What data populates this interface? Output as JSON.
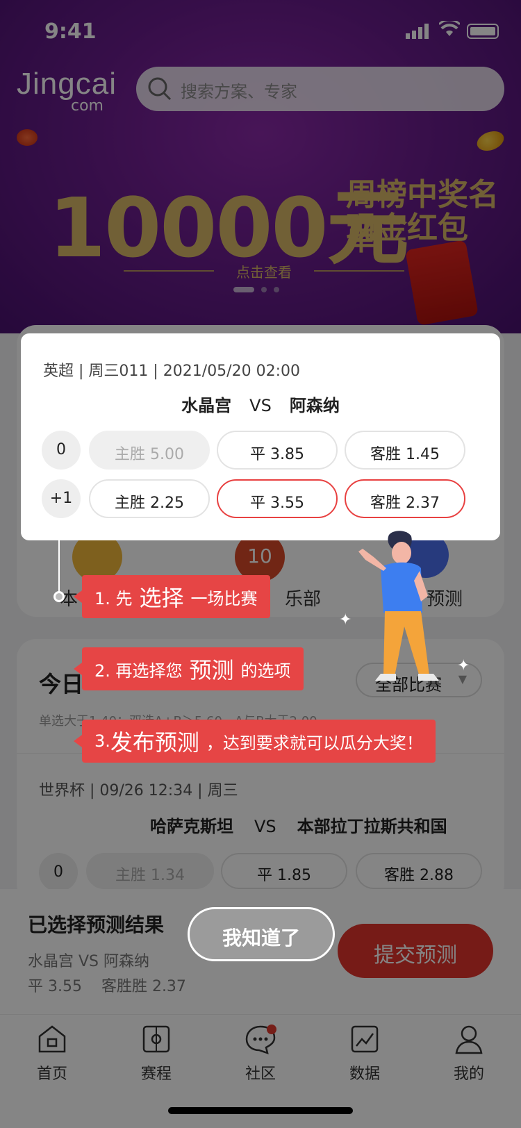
{
  "status_bar": {
    "time": "9:41"
  },
  "header": {
    "logo_main": "Jingcai",
    "logo_sub": "com",
    "search_placeholder": "搜索方案、专家"
  },
  "banner": {
    "amount": "10000元",
    "line1": "周榜中奖名单",
    "line2": "现金红包",
    "cta": "点击查看"
  },
  "highlight_match": {
    "meta": "英超 | 周三011 | 2021/05/20 02:00",
    "home": "水晶宫",
    "vs": "VS",
    "away": "阿森纳",
    "rows": [
      {
        "handicap": "0",
        "home": "主胜 5.00",
        "draw": "平 3.85",
        "away": "客胜 1.45"
      },
      {
        "handicap": "+1",
        "home": "主胜 2.25",
        "draw": "平 3.55",
        "away": "客胜 2.37"
      }
    ]
  },
  "icons_row": {
    "left_label": "本",
    "mid_badge": "10",
    "mid_label": "乐部",
    "right_label": "预测"
  },
  "today": {
    "title": "今日",
    "filter": "全部比赛",
    "hint": "单选大于1.40；双选A+B＞5.60，A与B大于2.00"
  },
  "match2": {
    "meta": "世界杯 | 09/26 12:34 | 周三",
    "home": "哈萨克斯坦",
    "vs": "VS",
    "away": "本部拉丁拉斯共和国",
    "handicap": "0",
    "home_odds": "主胜 1.34",
    "draw_odds": "平 1.85",
    "away_odds": "客胜 2.88"
  },
  "selection": {
    "title": "已选择预测结果",
    "match": "水晶宫 VS 阿森纳",
    "odds": "平 3.55    客胜胜 2.37",
    "submit": "提交预测"
  },
  "guide": {
    "step1": {
      "pre": "1. 先",
      "key": "选择",
      "post": "一场比赛"
    },
    "step2": {
      "pre": "2. 再选择您",
      "key": "预测",
      "post": "的选项"
    },
    "step3": {
      "pre": "3.",
      "key": "发布预测",
      "post": "，达到要求就可以瓜分大奖！"
    },
    "dismiss": "我知道了"
  },
  "tabs": [
    {
      "label": "首页",
      "icon": "home-icon"
    },
    {
      "label": "赛程",
      "icon": "schedule-icon"
    },
    {
      "label": "社区",
      "icon": "chat-icon"
    },
    {
      "label": "数据",
      "icon": "chart-icon"
    },
    {
      "label": "我的",
      "icon": "user-icon"
    }
  ],
  "colors": {
    "accent": "#e64545",
    "banner": "#6b1d8e",
    "gold": "#d8b868"
  }
}
